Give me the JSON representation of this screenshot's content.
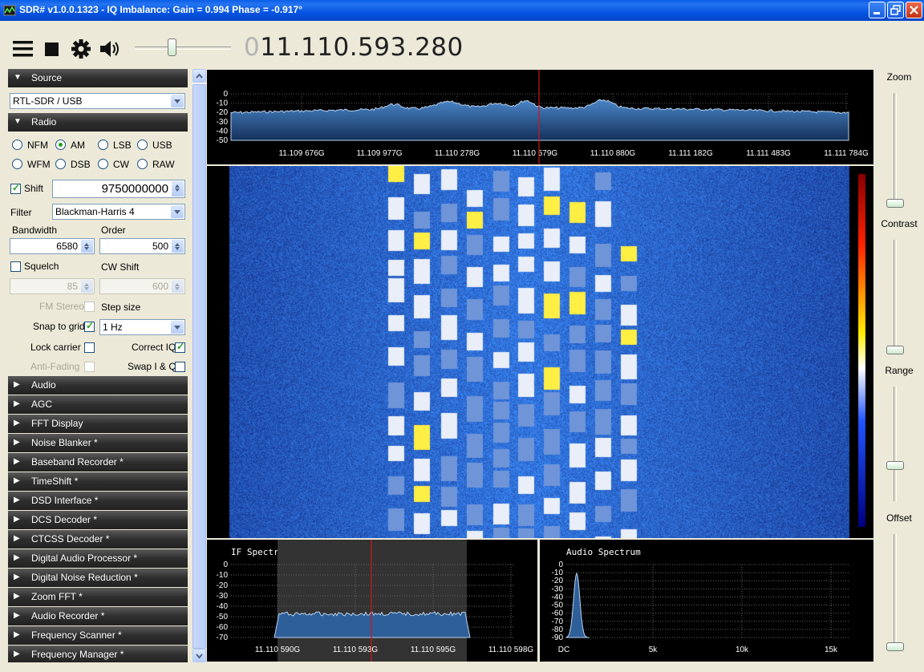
{
  "window": {
    "title": "SDR# v1.0.0.1323 - IQ Imbalance: Gain = 0.994 Phase = -0.917°"
  },
  "toolbar": {
    "icons": [
      "menu-icon",
      "stop-icon",
      "gear-icon",
      "speaker-icon"
    ],
    "frequency_leading_digit": "0",
    "frequency": "11.110.593.280",
    "volume_level": 0.4
  },
  "source": {
    "header": "Source",
    "device": "RTL-SDR / USB"
  },
  "radio": {
    "header": "Radio",
    "modes": [
      "NFM",
      "AM",
      "LSB",
      "USB",
      "WFM",
      "DSB",
      "CW",
      "RAW"
    ],
    "selected_mode": "AM",
    "shift_label": "Shift",
    "shift_checked": true,
    "shift_value": "9750000000",
    "filter_label": "Filter",
    "filter_value": "Blackman-Harris 4",
    "bandwidth_label": "Bandwidth",
    "bandwidth_value": "6580",
    "order_label": "Order",
    "order_value": "500",
    "squelch_label": "Squelch",
    "squelch_checked": false,
    "squelch_value": "85",
    "cwshift_label": "CW Shift",
    "cwshift_value": "600",
    "fmstereo_label": "FM Stereo",
    "stepsize_label": "Step size",
    "snap_label": "Snap to grid",
    "snap_checked": true,
    "step_value": "1 Hz",
    "lockcarrier_label": "Lock carrier",
    "correctiq_label": "Correct IQ",
    "correctiq_checked": true,
    "antifading_label": "Anti-Fading",
    "swapiq_label": "Swap I & Q"
  },
  "sections": [
    "Audio",
    "AGC",
    "FFT Display",
    "Noise Blanker *",
    "Baseband Recorder *",
    "TimeShift *",
    "DSD Interface *",
    "DCS Decoder *",
    "CTCSS Decoder *",
    "Digital Audio Processor *",
    "Digital Noise Reduction *",
    "Zoom FFT *",
    "Audio Recorder *",
    "Frequency Scanner *",
    "Frequency Manager *"
  ],
  "spectrum": {
    "y_ticks": [
      "0",
      "-10",
      "-20",
      "-30",
      "-40",
      "-50"
    ],
    "x_ticks": [
      "11.109 676G",
      "11.109 977G",
      "11.110 278G",
      "11.110 579G",
      "11.110 880G",
      "11.111 182G",
      "11.111 483G",
      "11.111 784G"
    ]
  },
  "if_spectrum": {
    "title": "IF Spectrum",
    "y_ticks": [
      "0",
      "-10",
      "-20",
      "-30",
      "-40",
      "-50",
      "-60",
      "-70"
    ],
    "x_ticks": [
      "11.110 590G",
      "11.110 593G",
      "11.110 595G",
      "11.110 598G"
    ]
  },
  "audio_spectrum": {
    "title": "Audio Spectrum",
    "y_ticks": [
      "0",
      "-10",
      "-20",
      "-30",
      "-40",
      "-50",
      "-60",
      "-70",
      "-80",
      "-90"
    ],
    "x_ticks": [
      "DC",
      "5k",
      "10k",
      "15k"
    ]
  },
  "right_sliders": {
    "zoom_label": "Zoom",
    "contrast_label": "Contrast",
    "range_label": "Range",
    "offset_label": "Offset",
    "zoom_level": 0.0,
    "contrast_level": 0.0,
    "range_level": 0.15,
    "offset_level": 0.0
  },
  "colors": {
    "spectrum_fill": "#2f6aa8",
    "marker": "#d01818",
    "waterfall_bg": "#1b3a9a",
    "signal_hot": "#ffee44"
  }
}
